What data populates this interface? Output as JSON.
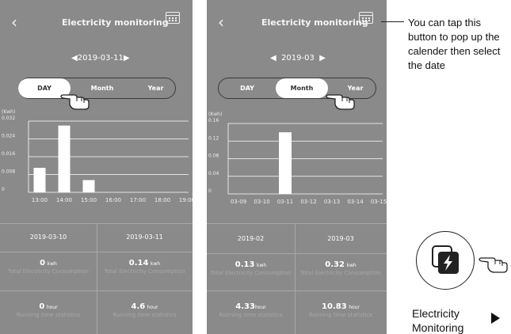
{
  "screen1": {
    "title": "Electricity monitoring",
    "date": "2019-03-11",
    "tabs": [
      "DAY",
      "Month",
      "Year"
    ],
    "active_tab": "DAY",
    "table": {
      "headers": [
        "2019-03-10",
        "2019-03-11"
      ],
      "consumption": [
        {
          "value": "0",
          "unit": "kwh"
        },
        {
          "value": "0.14",
          "unit": "kwh"
        }
      ],
      "consumption_caption": "Total Electricity Consumption",
      "runtime": [
        {
          "value": "0",
          "unit": "hour"
        },
        {
          "value": "4.6",
          "unit": "hour"
        }
      ],
      "runtime_caption": "Running time statistics"
    }
  },
  "screen2": {
    "title": "Electricity monitoring",
    "date": "2019-03",
    "tabs": [
      "DAY",
      "Month",
      "Year"
    ],
    "active_tab": "Month",
    "table": {
      "headers": [
        "2019-02",
        "2019-03"
      ],
      "consumption": [
        {
          "value": "0.13",
          "unit": "kwh"
        },
        {
          "value": "0.32",
          "unit": "kwh"
        }
      ],
      "consumption_caption": "Total Electricity Consumption",
      "runtime": [
        {
          "value": "4.33",
          "unit": "hour"
        },
        {
          "value": "10.83",
          "unit": "hour"
        }
      ],
      "runtime_caption": "Running time statistics"
    }
  },
  "chart_data": [
    {
      "type": "bar",
      "ylabel": "(Kwh)",
      "ylim": [
        0,
        0.032
      ],
      "yticks": [
        "0",
        "0.008",
        "0.016",
        "0.024",
        "0.032"
      ],
      "categories": [
        "13:00",
        "14:00",
        "15:00",
        "16:00",
        "17:00",
        "18:00",
        "19:00"
      ],
      "values": [
        0.011,
        0.03,
        0.0055,
        0,
        0,
        0,
        0
      ]
    },
    {
      "type": "bar",
      "ylabel": "(Kwh)",
      "ylim": [
        0,
        0.16
      ],
      "yticks": [
        "0",
        "0.04",
        "0.08",
        "0.12",
        "0.16"
      ],
      "categories": [
        "03-09",
        "03-10",
        "03-11",
        "03-12",
        "03-13",
        "03-14",
        "03-15"
      ],
      "values": [
        0,
        0,
        0.14,
        0,
        0,
        0,
        0
      ]
    }
  ],
  "callout": "You can tap this button to pop up the calender then select the date",
  "feature_label": "Electricity Monitoring",
  "colors": {
    "screen_bg": "#8a8a8a",
    "bar": "#ffffff",
    "active_tab_bg": "#ffffff"
  },
  "icons": [
    "back-icon",
    "calendar-icon",
    "hand-pointer-icon",
    "electricity-monitoring-icon"
  ]
}
